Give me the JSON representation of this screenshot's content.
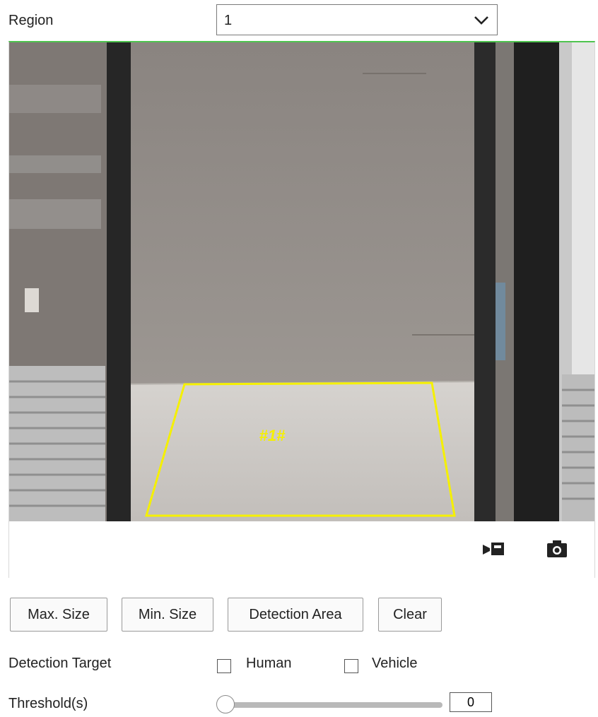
{
  "region": {
    "label": "Region",
    "selected": "1"
  },
  "video": {
    "zone_tag": "#1#",
    "zone_color": "#f5f000",
    "panel_accent": "#4fc44f",
    "toolbar": {
      "record_icon": "record-icon",
      "capture_icon": "camera-icon"
    }
  },
  "buttons": {
    "max_size": "Max. Size",
    "min_size": "Min. Size",
    "detection_area": "Detection Area",
    "clear": "Clear"
  },
  "detection_target": {
    "label": "Detection Target",
    "options": [
      {
        "label": "Human",
        "checked": false
      },
      {
        "label": "Vehicle",
        "checked": false
      }
    ]
  },
  "threshold": {
    "label": "Threshold(s)",
    "value": "0",
    "slider_fraction": 0
  }
}
